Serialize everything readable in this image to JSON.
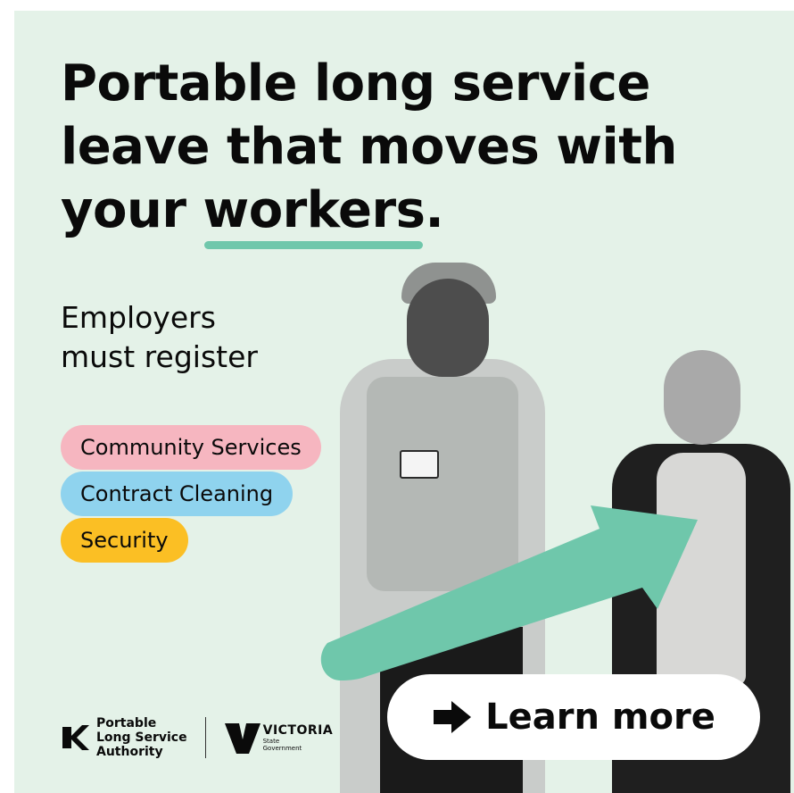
{
  "headline": {
    "line1": "Portable long service",
    "line2": "leave that moves with",
    "line3_before": "your ",
    "line3_highlight": "workers",
    "line3_after": "."
  },
  "subhead": {
    "line1": "Employers",
    "line2": "must register"
  },
  "sectors": [
    {
      "label": "Community Services",
      "color": "#f6b6c0"
    },
    {
      "label": "Contract Cleaning",
      "color": "#8fd3ee"
    },
    {
      "label": "Security",
      "color": "#fbbf24"
    }
  ],
  "cta": {
    "label": "Learn more",
    "icon": "arrow-right-icon"
  },
  "logos": {
    "plsa": {
      "line1": "Portable",
      "line2": "Long Service",
      "line3": "Authority"
    },
    "victoria": {
      "word": "VICTORIA",
      "sub1": "State",
      "sub2": "Government"
    }
  },
  "colors": {
    "background": "#e4f2e8",
    "accent": "#6fc7ab",
    "text": "#0a0a0a"
  }
}
